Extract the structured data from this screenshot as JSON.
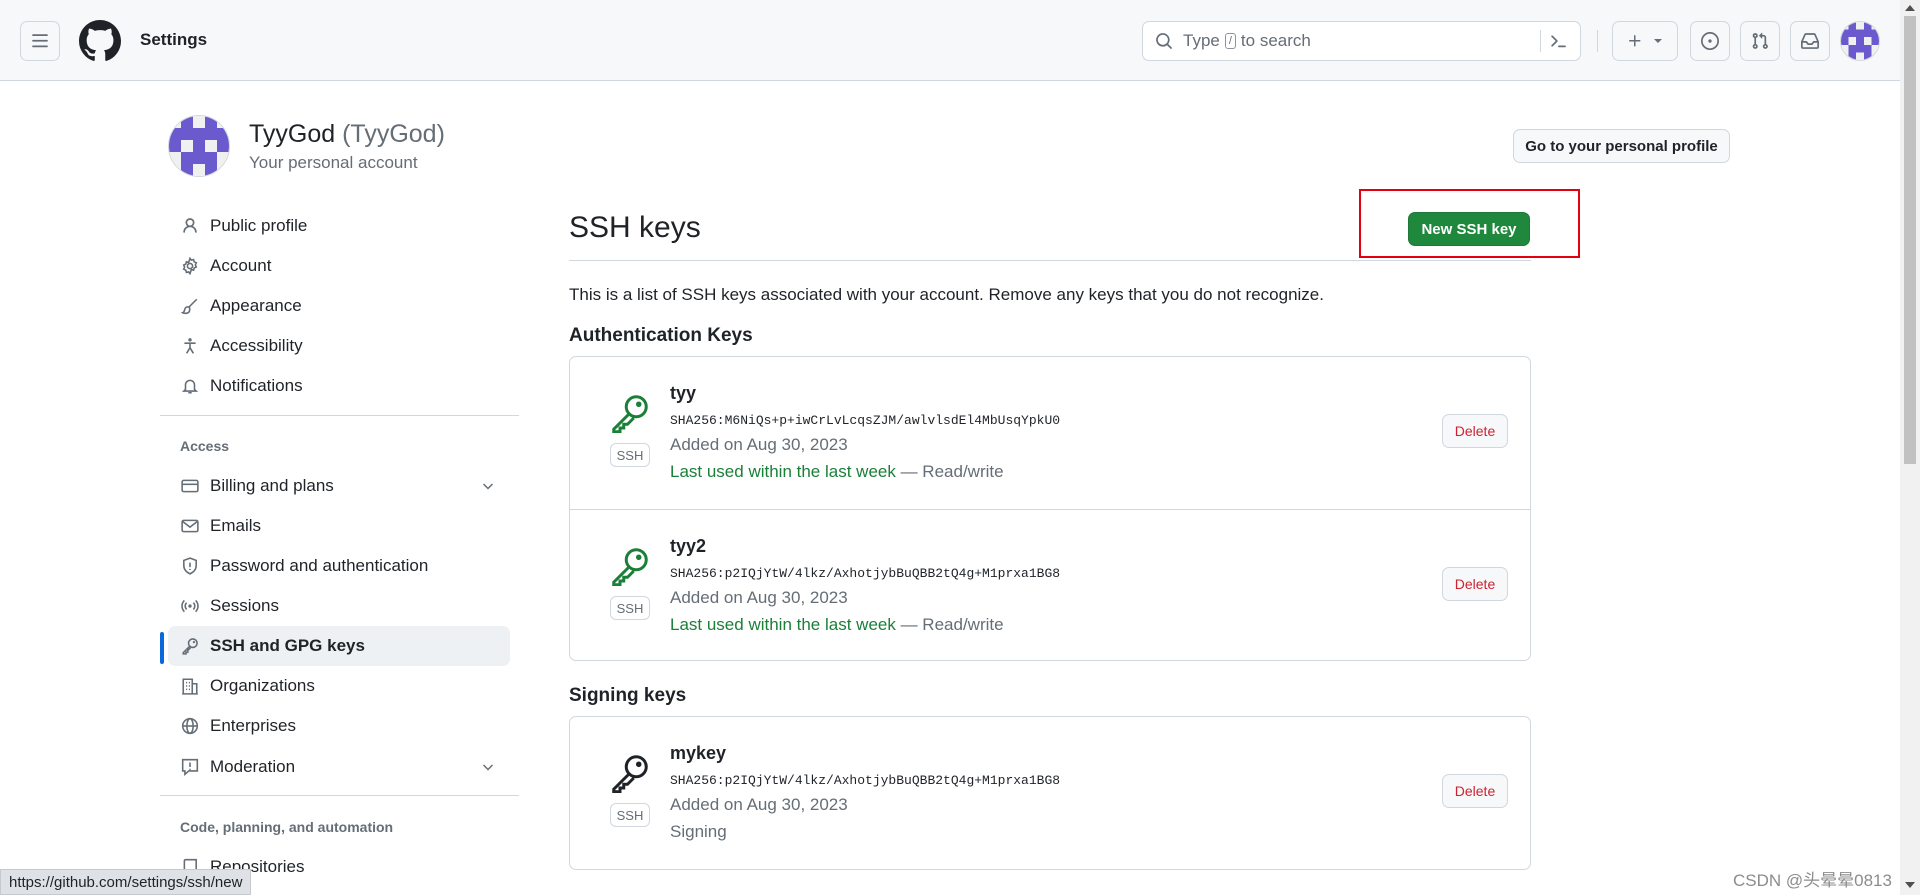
{
  "header": {
    "context_title": "Settings",
    "search_placeholder_prefix": "Type",
    "search_key": "/",
    "search_placeholder_suffix": "to search",
    "icons": [
      "menu-icon",
      "github-logo-icon",
      "search-icon",
      "command-palette-icon",
      "plus-icon",
      "issues-icon",
      "pull-requests-icon",
      "inbox-icon"
    ]
  },
  "account": {
    "display_name": "TyyGod",
    "login": "(TyyGod)",
    "subtitle": "Your personal account",
    "profile_button": "Go to your personal profile"
  },
  "sidebar": {
    "items_top": [
      {
        "label": "Public profile",
        "icon": "person-icon"
      },
      {
        "label": "Account",
        "icon": "gear-icon"
      },
      {
        "label": "Appearance",
        "icon": "paintbrush-icon"
      },
      {
        "label": "Accessibility",
        "icon": "accessibility-icon"
      },
      {
        "label": "Notifications",
        "icon": "bell-icon"
      }
    ],
    "access_heading": "Access",
    "items_access": [
      {
        "label": "Billing and plans",
        "icon": "credit-card-icon"
      },
      {
        "label": "Emails",
        "icon": "mail-icon"
      },
      {
        "label": "Password and authentication",
        "icon": "shield-icon"
      },
      {
        "label": "Sessions",
        "icon": "broadcast-icon"
      },
      {
        "label": "SSH and GPG keys",
        "icon": "key-icon"
      },
      {
        "label": "Organizations",
        "icon": "organization-icon"
      },
      {
        "label": "Enterprises",
        "icon": "globe-icon"
      },
      {
        "label": "Moderation",
        "icon": "report-icon"
      }
    ],
    "code_heading": "Code, planning, and automation",
    "items_code": [
      {
        "label": "Repositories",
        "icon": "repo-icon"
      }
    ]
  },
  "main": {
    "title": "SSH keys",
    "new_button": "New SSH key",
    "description": "This is a list of SSH keys associated with your account. Remove any keys that you do not recognize.",
    "auth_heading": "Authentication Keys",
    "signing_heading": "Signing keys",
    "badge": "SSH",
    "delete_label": "Delete",
    "auth_keys": [
      {
        "title": "tyy",
        "fingerprint": "SHA256:M6NiQs+p+iwCrLvLcqsZJM/awlvlsdEl4MbUsqYpkU0",
        "added": "Added on Aug 30, 2023",
        "used": "Last used within the last week",
        "access": " — Read/write"
      },
      {
        "title": "tyy2",
        "fingerprint": "SHA256:p2IQjYtW/4lkz/AxhotjybBuQBB2tQ4g+M1prxa1BG8",
        "added": "Added on Aug 30, 2023",
        "used": "Last used within the last week",
        "access": " — Read/write"
      }
    ],
    "signing_keys": [
      {
        "title": "mykey",
        "fingerprint": "SHA256:p2IQjYtW/4lkz/AxhotjybBuQBB2tQ4g+M1prxa1BG8",
        "added": "Added on Aug 30, 2023",
        "usage": "Signing"
      }
    ]
  },
  "status_url": "https://github.com/settings/ssh/new",
  "watermark": "CSDN @头晕晕0813",
  "colors": {
    "green_button": "#1f883d",
    "success_text": "#1a7f37",
    "danger_text": "#cf222e",
    "active_indicator": "#0969da",
    "highlight_box": "#e3000f",
    "identicon": "#6a5acd"
  }
}
